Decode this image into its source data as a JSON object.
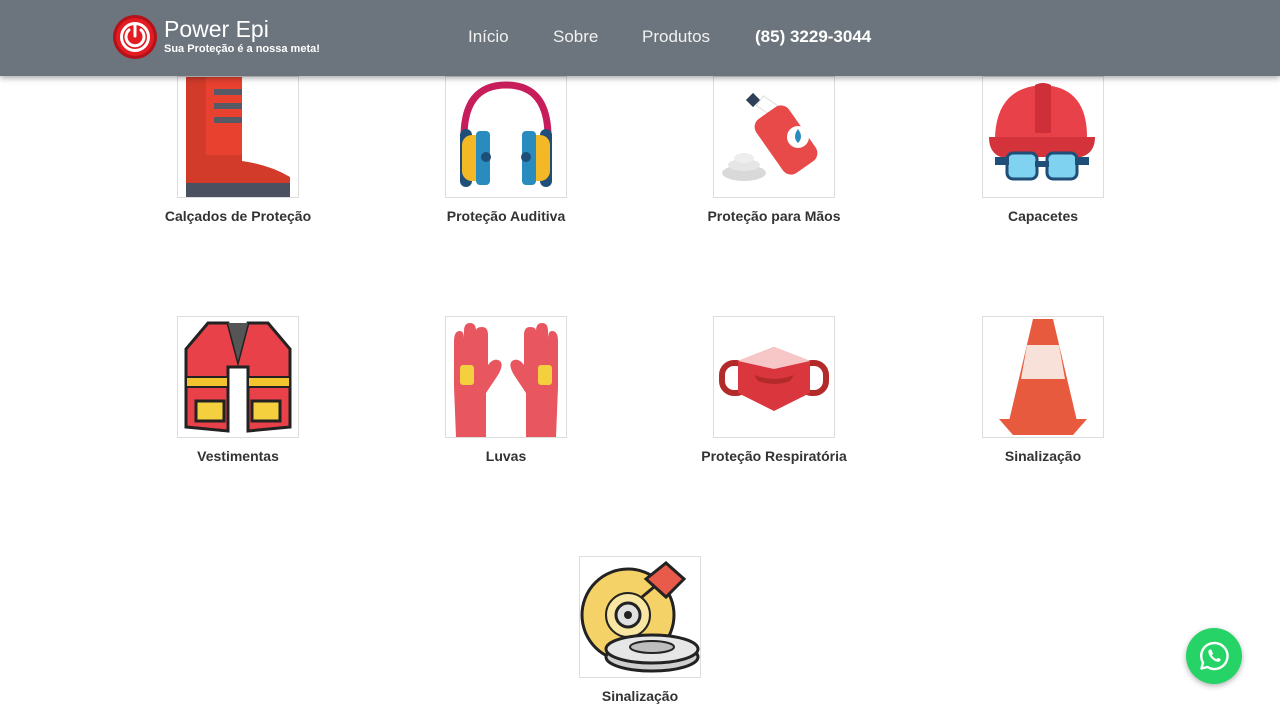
{
  "header": {
    "brand_name": "Power Epi",
    "tagline": "Sua Proteção é a nossa meta!",
    "nav": {
      "home": "Início",
      "about": "Sobre",
      "products": "Produtos",
      "phone": "(85) 3229-3044"
    }
  },
  "products": [
    {
      "label": "Calçados de Proteção",
      "icon": "boot-icon"
    },
    {
      "label": "Proteção Auditiva",
      "icon": "headphones-icon"
    },
    {
      "label": "Proteção para Mãos",
      "icon": "hand-cream-icon"
    },
    {
      "label": "Capacetes",
      "icon": "helmet-icon"
    },
    {
      "label": "Vestimentas",
      "icon": "vest-icon"
    },
    {
      "label": "Luvas",
      "icon": "gloves-icon"
    },
    {
      "label": "Proteção Respiratória",
      "icon": "mask-icon"
    },
    {
      "label": "Sinalização",
      "icon": "traffic-cone-icon"
    },
    {
      "label": "Sinalização",
      "icon": "grinding-disc-icon"
    }
  ],
  "whatsapp": {
    "icon": "whatsapp-icon"
  },
  "colors": {
    "navbar": "#6c757d",
    "brand_red": "#e31b23",
    "whatsapp_green": "#25d366"
  }
}
